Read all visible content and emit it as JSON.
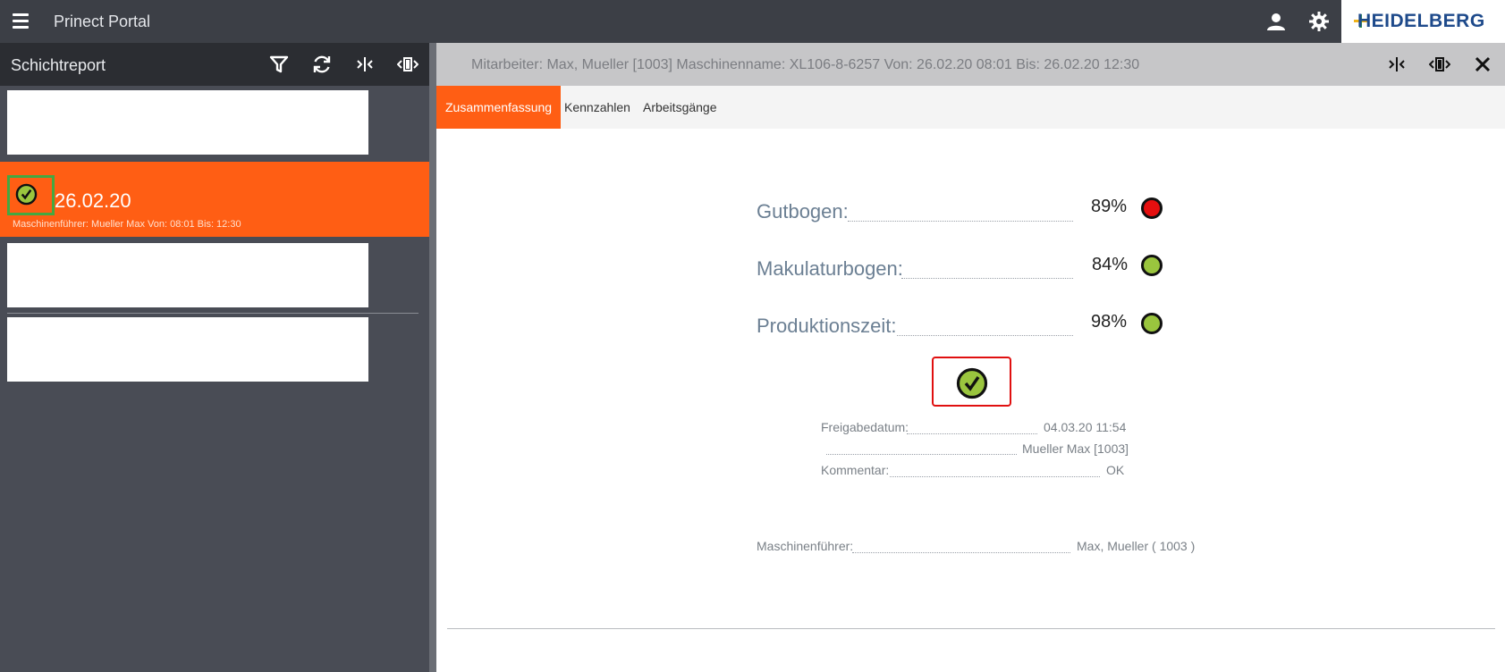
{
  "app": {
    "title": "Prinect Portal",
    "logo": "HEIDELBERG"
  },
  "icons": {
    "menu": "hamburger-icon",
    "user": "user-icon",
    "settings": "gear-icon",
    "filter": "filter-icon",
    "refresh": "refresh-icon",
    "collapse": "collapse-icon",
    "expand": "expand-icon",
    "close": "close-icon",
    "status_ok": "check-circle-icon"
  },
  "left": {
    "title": "Schichtreport",
    "selected": {
      "date": "26.02.20",
      "subtitle": "Maschinenführer: Mueller Max Von: 08:01 Bis: 12:30"
    }
  },
  "right": {
    "header": "Mitarbeiter: Max, Mueller [1003] Maschinenname: XL106-8-6257 Von: 26.02.20 08:01 Bis: 26.02.20 12:30",
    "tabs": [
      {
        "label": "Zusammenfassung",
        "active": true
      },
      {
        "label": "Kennzahlen",
        "active": false
      },
      {
        "label": "Arbeitsgänge",
        "active": false
      }
    ],
    "kpis": [
      {
        "label": "Gutbogen:",
        "value": "89%",
        "status": "red"
      },
      {
        "label": "Makulaturbogen:",
        "value": "84%",
        "status": "green"
      },
      {
        "label": "Produktionszeit:",
        "value": "98%",
        "status": "green"
      }
    ],
    "approval": {
      "date_label": "Freigabedatum:",
      "date_value": "04.03.20 11:54",
      "approver_value": "Mueller Max [1003]",
      "comment_label": "Kommentar:",
      "comment_value": "OK"
    },
    "operator": {
      "label": "Maschinenführer:",
      "value": "Max, Mueller ( 1003 )"
    }
  },
  "colors": {
    "accent": "#ff5e14",
    "green": "#9ac53e",
    "red": "#e60f0f",
    "topbar": "#3c3f46"
  }
}
